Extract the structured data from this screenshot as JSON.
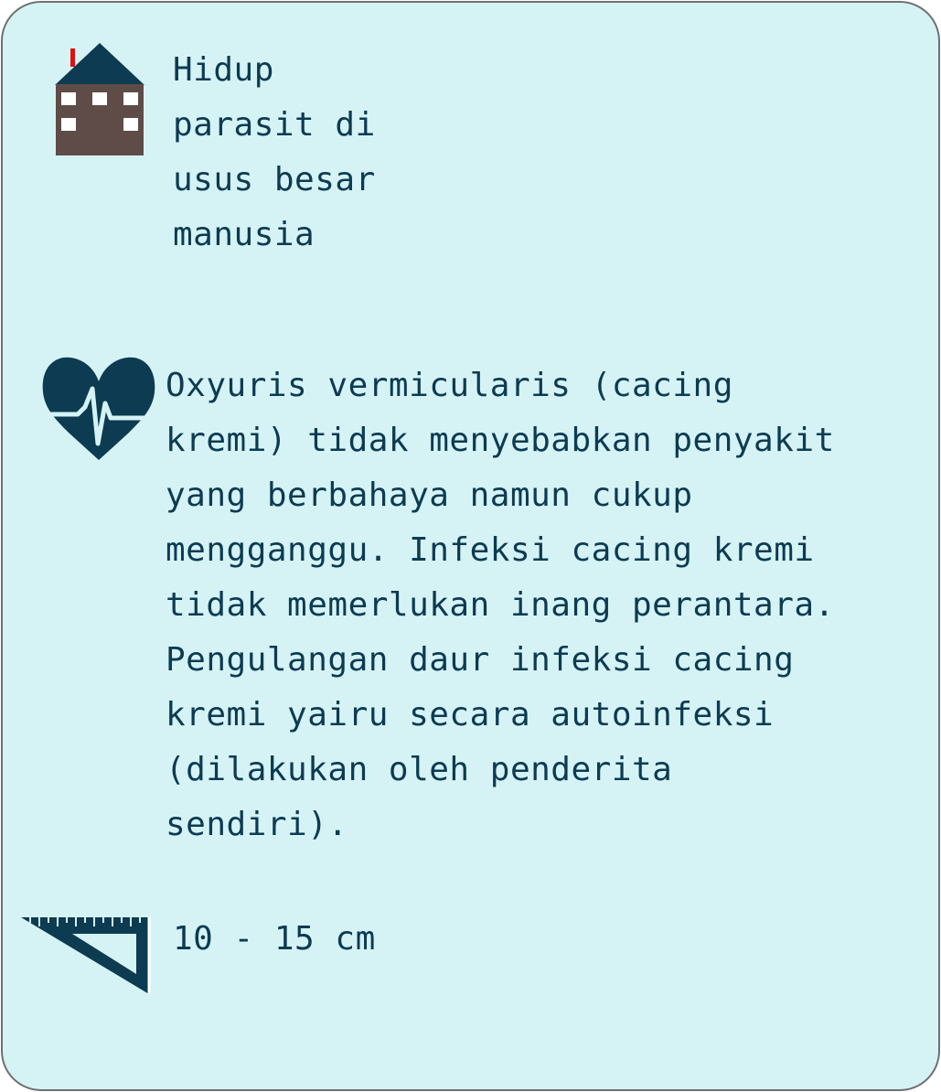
{
  "habitat": {
    "icon": "house-icon",
    "text": "Hidup\nparasit di\nusus besar\nmanusia"
  },
  "description": {
    "icon": "heart-pulse-icon",
    "text": "Oxyuris vermicularis (cacing\nkremi) tidak menyebabkan penyakit\nyang berbahaya namun cukup\nmengganggu. Infeksi cacing kremi\ntidak memerlukan inang perantara.\nPengulangan daur infeksi cacing\nkremi yairu secara autoinfeksi\n(dilakukan oleh penderita\nsendiri)."
  },
  "size": {
    "icon": "set-square-ruler-icon",
    "text": "10 - 15 cm"
  },
  "colors": {
    "card_background": "#d5f3f5",
    "text": "#0c3b52",
    "roof": "#0c3b52",
    "house_wall": "#5f4b47",
    "chimney": "#e01010"
  }
}
